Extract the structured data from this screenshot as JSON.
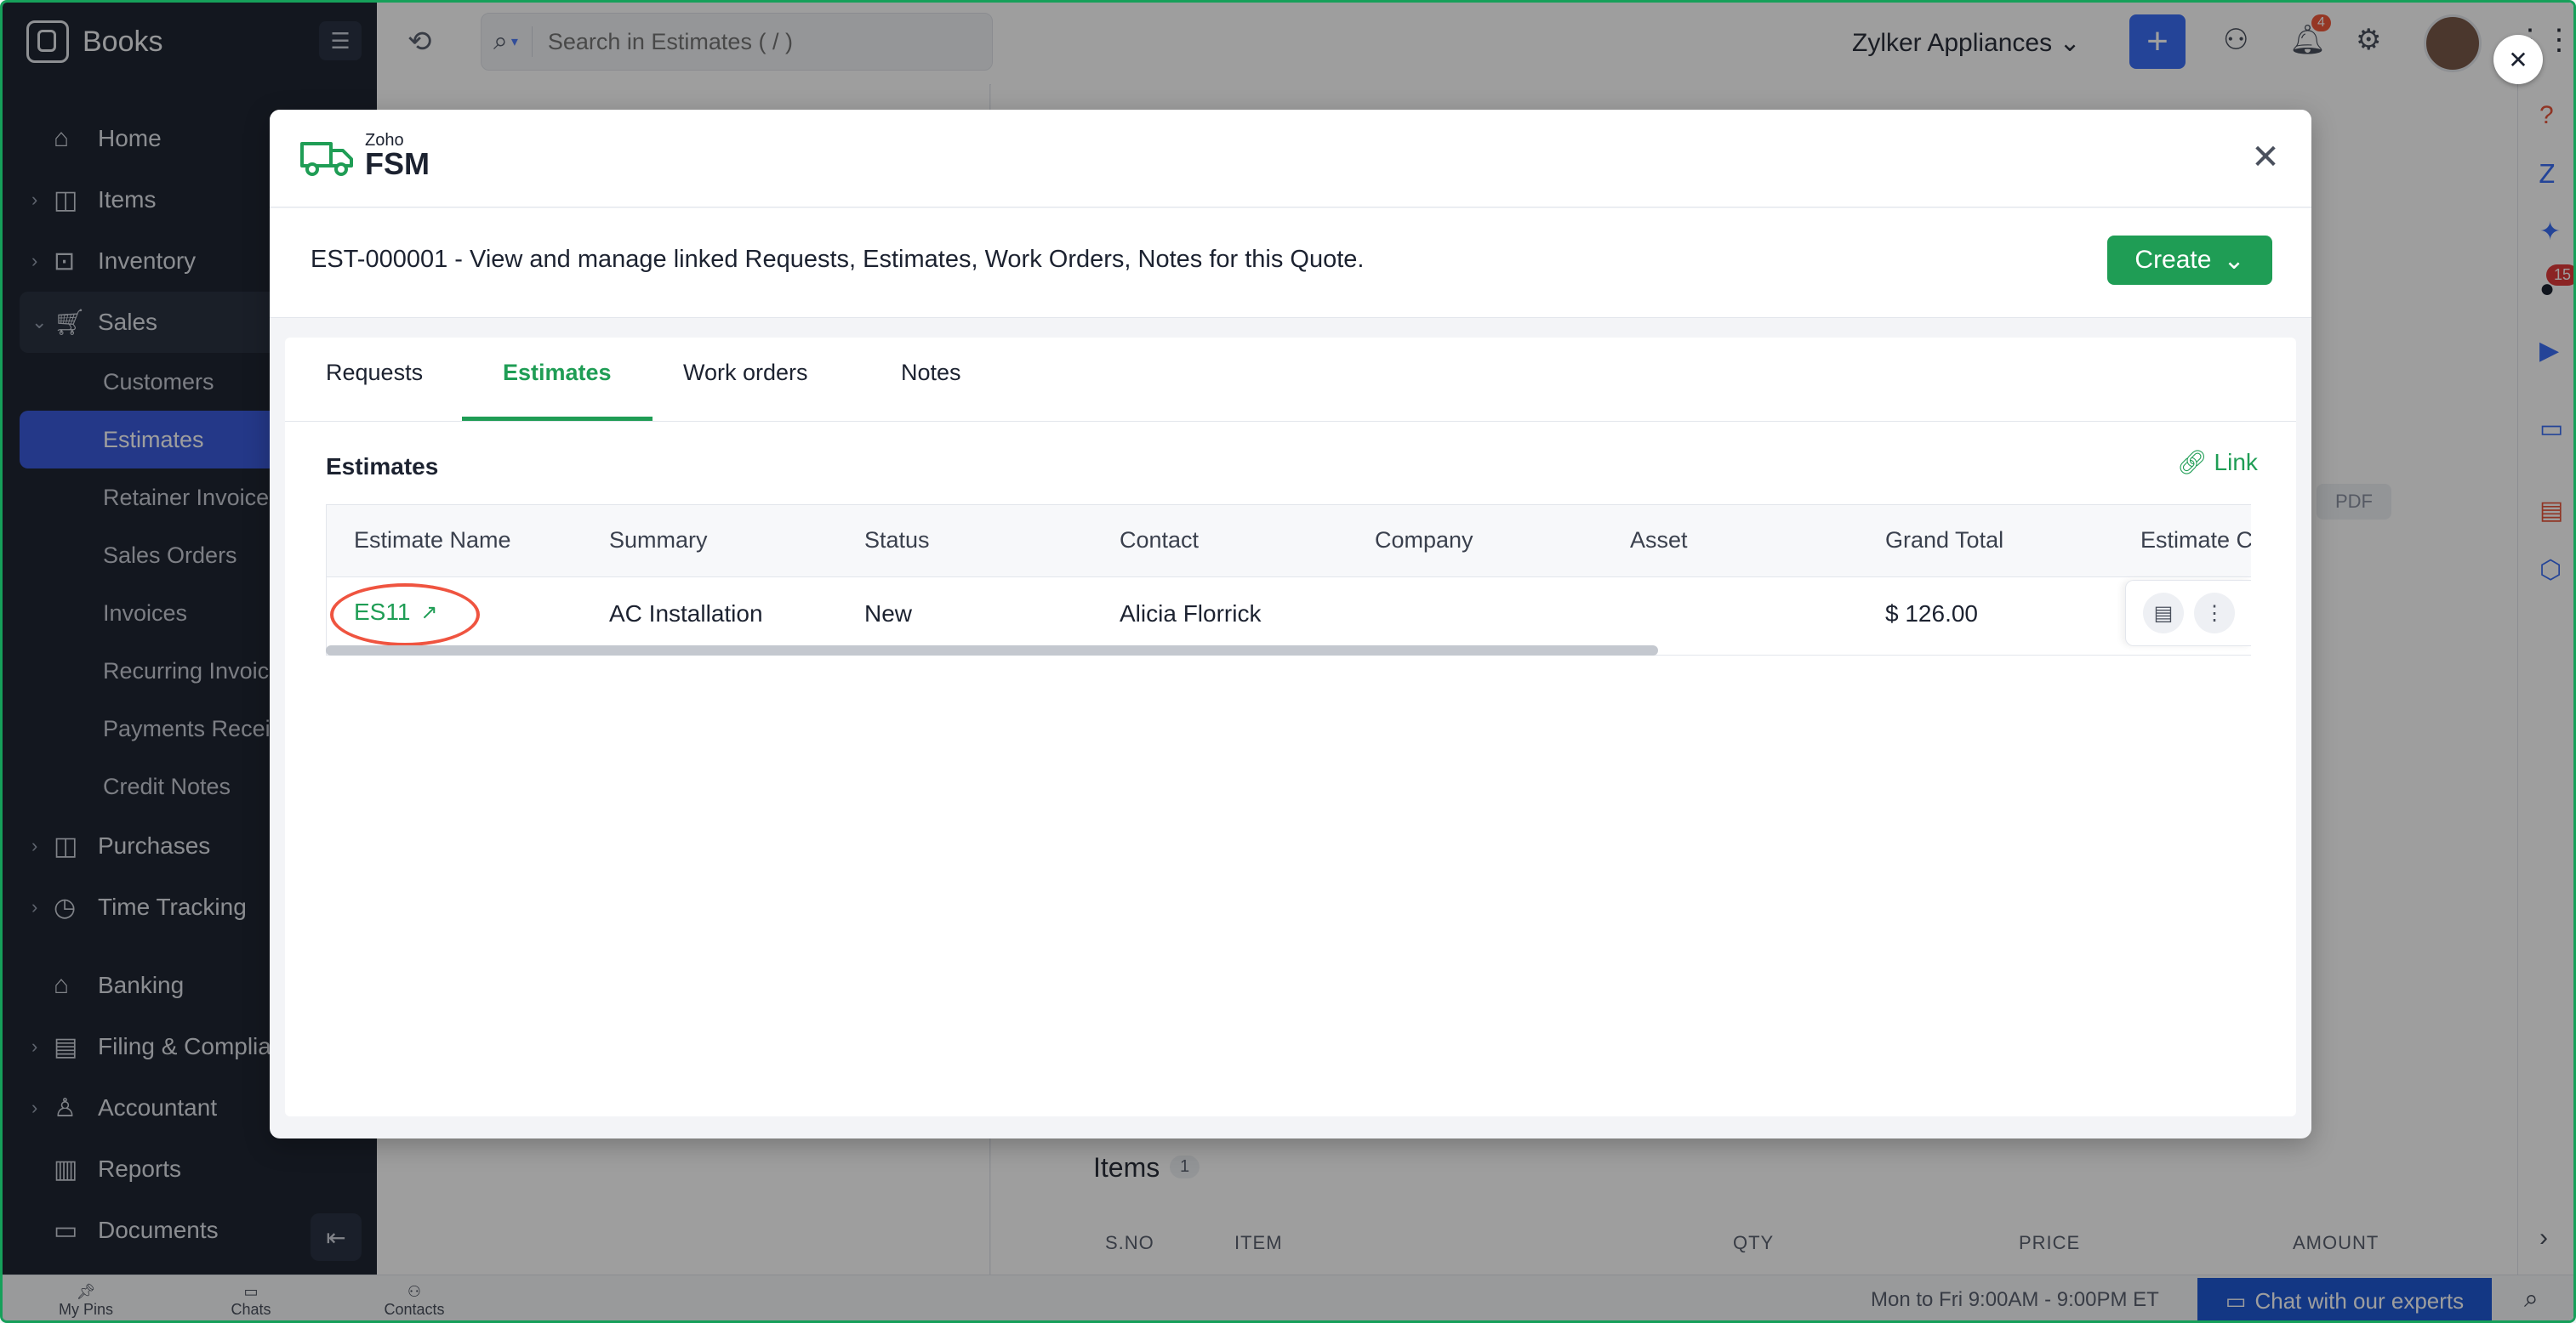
{
  "app": {
    "name": "Books"
  },
  "sidebar": {
    "items": [
      {
        "label": "Home",
        "icon": "home-icon"
      },
      {
        "label": "Items",
        "icon": "bag-icon"
      },
      {
        "label": "Inventory",
        "icon": "box-icon"
      },
      {
        "label": "Sales",
        "icon": "cart-icon"
      }
    ],
    "sales_sub": [
      {
        "label": "Customers"
      },
      {
        "label": "Estimates",
        "active": true
      },
      {
        "label": "Retainer Invoice"
      },
      {
        "label": "Sales Orders"
      },
      {
        "label": "Invoices"
      },
      {
        "label": "Recurring Invoic"
      },
      {
        "label": "Payments Recei"
      },
      {
        "label": "Credit Notes"
      }
    ],
    "items2": [
      {
        "label": "Purchases",
        "icon": "bag-icon"
      },
      {
        "label": "Time Tracking",
        "icon": "clock-icon"
      },
      {
        "label": "Banking",
        "icon": "bank-icon"
      },
      {
        "label": "Filing & Complia",
        "icon": "file-icon"
      },
      {
        "label": "Accountant",
        "icon": "user-icon"
      },
      {
        "label": "Reports",
        "icon": "chart-icon"
      },
      {
        "label": "Documents",
        "icon": "folder-icon"
      }
    ]
  },
  "header": {
    "search_placeholder": "Search in Estimates ( / )",
    "org": "Zylker Appliances",
    "notification_count": "4"
  },
  "background": {
    "items_title": "Items",
    "items_count": "1",
    "columns": [
      "S.NO",
      "ITEM",
      "QTY",
      "PRICE",
      "AMOUNT"
    ],
    "pdf_label": "PDF"
  },
  "rail": {
    "badge": "15"
  },
  "bottom": {
    "my_pins": "My Pins",
    "chats": "Chats",
    "contacts": "Contacts",
    "hours": "Mon to Fri 9:00AM - 9:00PM ET",
    "chat_experts": "Chat with our experts"
  },
  "modal": {
    "logo_small": "Zoho",
    "logo_big": "FSM",
    "description": "EST-000001 - View and manage linked Requests, Estimates, Work Orders, Notes for this Quote.",
    "create_label": "Create",
    "tabs": [
      "Requests",
      "Estimates",
      "Work orders",
      "Notes"
    ],
    "active_tab": "Estimates",
    "section_title": "Estimates",
    "link_label": "Link",
    "table": {
      "columns": [
        "Estimate Name",
        "Summary",
        "Status",
        "Contact",
        "Company",
        "Asset",
        "Grand Total",
        "Estimate C"
      ],
      "rows": [
        {
          "name": "ES11",
          "summary": "AC Installation",
          "status": "New",
          "contact": "Alicia Florrick",
          "company": "",
          "asset": "",
          "grand_total": "$ 126.00"
        }
      ]
    }
  },
  "colors": {
    "accent": "#1f9d55",
    "brand_blue": "#3b6ff5",
    "sidebar_bg": "#1f2633",
    "highlight": "#ef5440"
  }
}
